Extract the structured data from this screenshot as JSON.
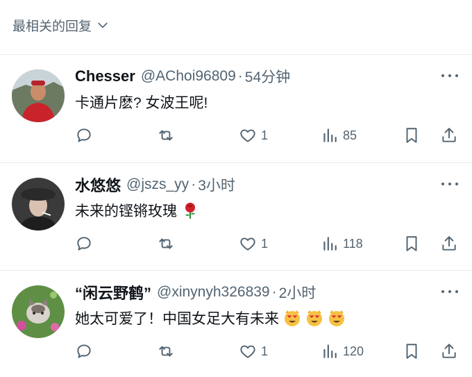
{
  "sort": {
    "label": "最相关的回复"
  },
  "replies": [
    {
      "name": "Chesser",
      "handle": "@AChoi96809",
      "dot": "·",
      "time": "54分钟",
      "text": "卡通片麽? 女波王呢!",
      "emoji": [],
      "likes": "1",
      "views": "85"
    },
    {
      "name": "水悠悠",
      "handle": "@jszs_yy",
      "dot": "·",
      "time": "3小时",
      "text": "未来的铿锵玫瑰",
      "emoji": [
        "rose"
      ],
      "likes": "1",
      "views": "118"
    },
    {
      "name": "“闲云野鹤”",
      "handle": "@xinynyh326839",
      "dot": "·",
      "time": "2小时",
      "text": "她太可爱了！中国女足大有未来",
      "emoji": [
        "heart-eyes-cat",
        "heart-eyes-cat",
        "heart-eyes-cat"
      ],
      "likes": "1",
      "views": "120"
    }
  ],
  "colors": {
    "muted": "#536471",
    "text": "#0f1419",
    "divider": "#e6ecf0"
  }
}
